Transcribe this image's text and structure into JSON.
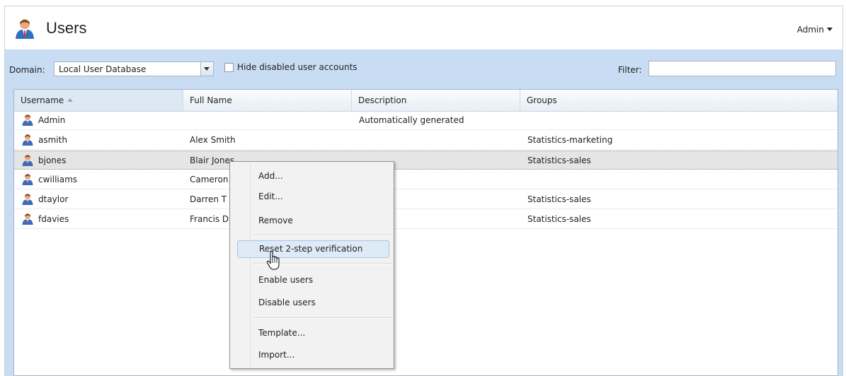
{
  "header": {
    "title": "Users",
    "user_menu": "Admin",
    "app_icon": "user-icon"
  },
  "toolbar": {
    "domain_label": "Domain:",
    "domain_value": "Local User Database",
    "hide_disabled_label": "Hide disabled user accounts",
    "hide_disabled_checked": false,
    "filter_label": "Filter:",
    "filter_value": ""
  },
  "table": {
    "columns": [
      "Username",
      "Full Name",
      "Description",
      "Groups"
    ],
    "sort_column": "Username",
    "rows": [
      {
        "username": "Admin",
        "full_name": "",
        "description": "Automatically generated",
        "groups": ""
      },
      {
        "username": "asmith",
        "full_name": "Alex Smith",
        "description": "",
        "groups": "Statistics-marketing"
      },
      {
        "username": "bjones",
        "full_name": "Blair Jones",
        "description": "",
        "groups": "Statistics-sales"
      },
      {
        "username": "cwilliams",
        "full_name": "Cameron",
        "description": "",
        "groups": ""
      },
      {
        "username": "dtaylor",
        "full_name": "Darren T",
        "description": "",
        "groups": "Statistics-sales"
      },
      {
        "username": "fdavies",
        "full_name": "Francis D",
        "description": "",
        "groups": "Statistics-sales"
      }
    ],
    "selected_row": "bjones"
  },
  "context_menu": {
    "add": "Add...",
    "edit": "Edit...",
    "remove": "Remove",
    "reset_2step": "Reset 2-step verification",
    "enable_users": "Enable users",
    "disable_users": "Disable users",
    "template": "Template...",
    "import": "Import...",
    "hovered": "Reset 2-step verification"
  },
  "colors": {
    "toolbar_bg": "#c8dcf3",
    "selected_row_bg": "#e5e5e5",
    "menu_hover_bg": "#dfeaf7",
    "user_icon_blue": "#2f6fc4",
    "user_icon_red": "#d9342b"
  }
}
